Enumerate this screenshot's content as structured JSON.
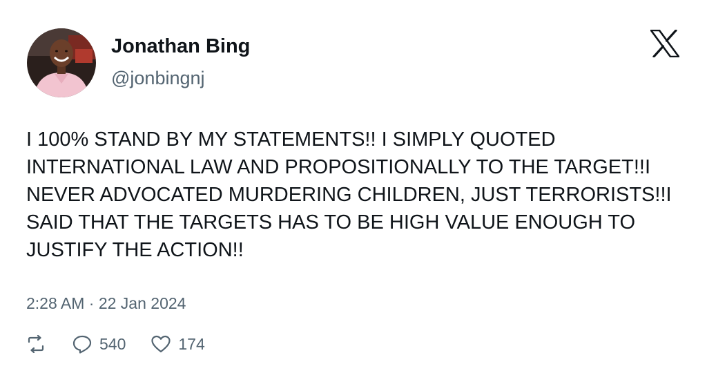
{
  "author": {
    "display_name": "Jonathan Bing",
    "handle": "@jonbingnj",
    "avatar_icon": "profile-photo"
  },
  "platform_icon": "x-logo-icon",
  "tweet": {
    "text": "I 100% STAND BY MY STATEMENTS!! I SIMPLY QUOTED\nINTERNATIONAL LAW AND PROPOSITIONALLY TO THE TARGET!!I\nNEVER ADVOCATED MURDERING CHILDREN, JUST TERRORISTS!!I\nSAID THAT THE TARGETS HAS TO BE HIGH VALUE ENOUGH TO\nJUSTIFY THE ACTION!!",
    "timestamp": "2:28 AM · 22 Jan 2024"
  },
  "actions": {
    "retweet_icon": "retweet-icon",
    "reply_icon": "reply-icon",
    "reply_count": "540",
    "like_icon": "heart-icon",
    "like_count": "174"
  },
  "colors": {
    "text_primary": "#0f1419",
    "text_secondary": "#536471",
    "background": "#ffffff"
  }
}
